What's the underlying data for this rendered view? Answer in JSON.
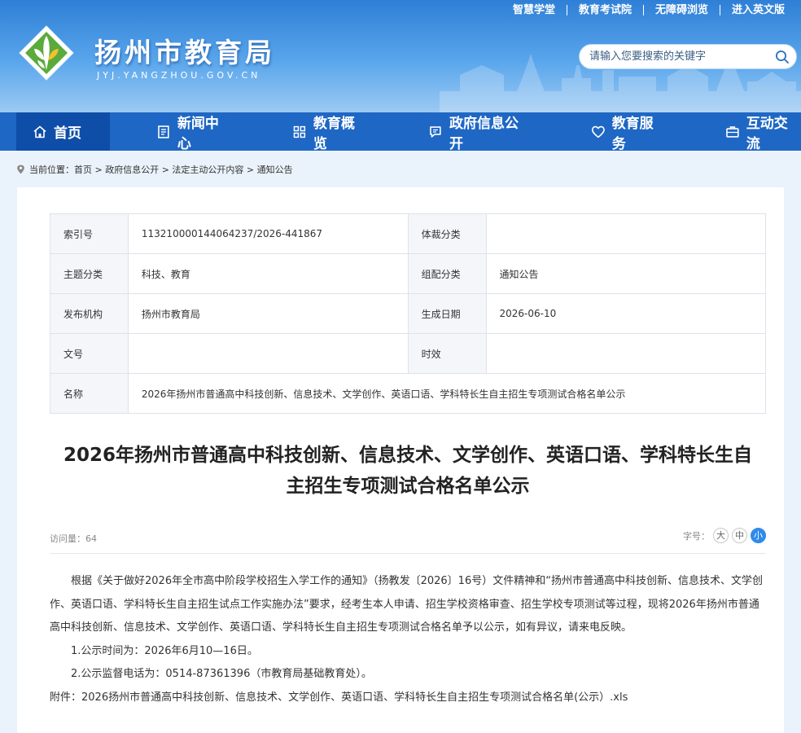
{
  "header": {
    "top_links": [
      "智慧学堂",
      "教育考试院",
      "无障碍浏览",
      "进入英文版"
    ],
    "site_title": "扬州市教育局",
    "site_domain": "JYJ.YANGZHOU.GOV.CN",
    "search_placeholder": "请输入您要搜索的关键字"
  },
  "nav": {
    "items": [
      {
        "label": "首页",
        "icon": "home-icon"
      },
      {
        "label": "新闻中心",
        "icon": "news-icon"
      },
      {
        "label": "教育概览",
        "icon": "grid-icon"
      },
      {
        "label": "政府信息公开",
        "icon": "chat-icon"
      },
      {
        "label": "教育服务",
        "icon": "heart-icon"
      },
      {
        "label": "互动交流",
        "icon": "briefcase-icon"
      }
    ]
  },
  "breadcrumb": {
    "text": "当前位置：首页 > 政府信息公开 > 法定主动公开内容 > 通知公告"
  },
  "meta": {
    "index_label": "索引号",
    "index_value": "113210000144064237/2026-441867",
    "genre_label": "体裁分类",
    "genre_value": "",
    "theme_label": "主题分类",
    "theme_value": "科技、教育",
    "group_label": "组配分类",
    "group_value": "通知公告",
    "publisher_label": "发布机构",
    "publisher_value": "扬州市教育局",
    "date_label": "生成日期",
    "date_value": "2026-06-10",
    "docno_label": "文号",
    "docno_value": "",
    "validity_label": "时效",
    "validity_value": "",
    "name_label": "名称",
    "name_value": "2026年扬州市普通高中科技创新、信息技术、文学创作、英语口语、学科特长生自主招生专项测试合格名单公示"
  },
  "article": {
    "title_line1": "2026年扬州市普通高中科技创新、信息技术、文学创作、英语口语、学科特长生自",
    "title_line2": "主招生专项测试合格名单公示",
    "views": "访问量：64",
    "font_size_label": "字号：",
    "font_sizes": [
      "大",
      "中",
      "小"
    ],
    "para1": "根据《关于做好2026年全市高中阶段学校招生入学工作的通知》（扬教发〔2026〕16号）文件精神和“扬州市普通高中科技创新、信息技术、文学创作、英语口语、学科特长生自主招生试点工作实施办法”要求，经考生本人申请、招生学校资格审查、招生学校专项测试等过程，现将2026年扬州市普通高中科技创新、信息技术、文学创作、英语口语、学科特长生自主招生专项测试合格名单予以公示，如有异议，请来电反映。",
    "para2": "1.公示时间为：2026年6月10—16日。",
    "para3": "2.公示监督电话为：0514-87361396（市教育局基础教育处）。",
    "attachment_label": "附件：",
    "attachment_link": "2026扬州市普通高中科技创新、信息技术、文学创作、英语口语、学科特长生自主招生专项测试合格名单(公示）.xls"
  },
  "colors": {
    "nav_bg": "#1f67c4",
    "nav_active": "#0f4ea8",
    "header_top": "#2e7fd6",
    "accent": "#2f8bea"
  }
}
